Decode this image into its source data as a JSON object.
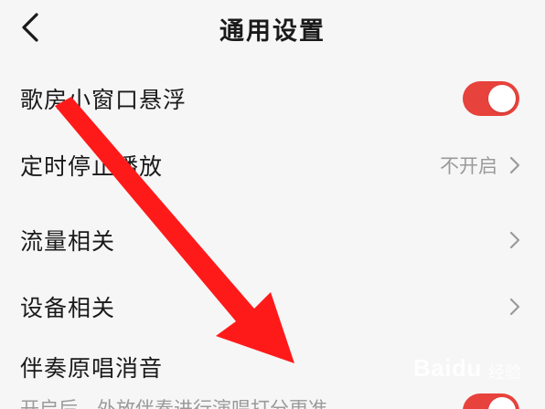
{
  "header": {
    "title": "通用设置",
    "back_icon": "chevron-left-icon"
  },
  "settings": [
    {
      "label": "歌房小窗口悬浮",
      "control": "toggle",
      "on": true
    },
    {
      "label": "定时停止播放",
      "control": "link",
      "value": "不开启"
    },
    {
      "label": "流量相关",
      "control": "link"
    },
    {
      "label": "设备相关",
      "control": "link"
    },
    {
      "label": "伴奏原唱消音",
      "control": "toggle",
      "on": true
    }
  ],
  "partial_description": "开启后，外放伴奏进行演唱打分更准",
  "watermark": {
    "text": "Baidu",
    "subtext": "经验"
  },
  "colors": {
    "accent": "#e8423c",
    "arrow": "#ff1a1a",
    "background": "#f6f6f6",
    "secondary_text": "#9a9a9a"
  }
}
